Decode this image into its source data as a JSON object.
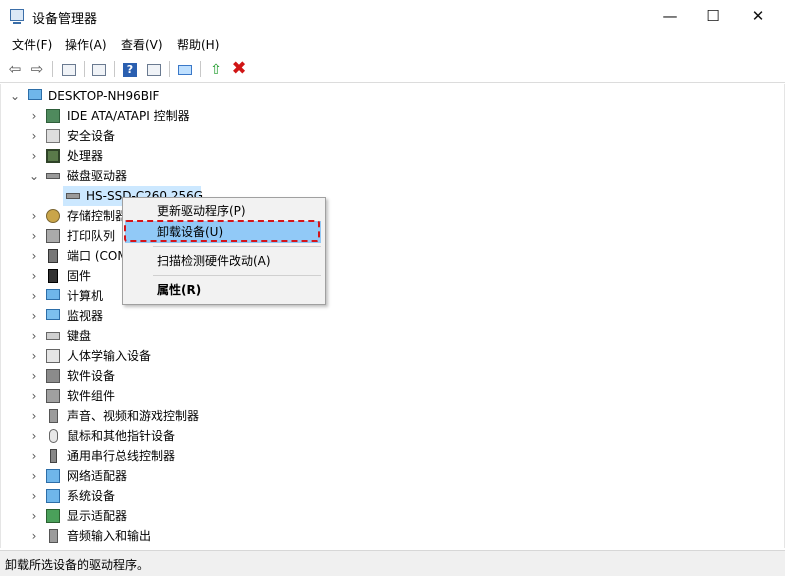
{
  "window": {
    "title": "设备管理器",
    "minimize_glyph": "—",
    "maximize_glyph": "☐",
    "close_glyph": "✕"
  },
  "menu": [
    "文件(F)",
    "操作(A)",
    "查看(V)",
    "帮助(H)"
  ],
  "toolbar": {
    "back_glyph": "⇦",
    "forward_glyph": "⇨",
    "help_glyph": "?",
    "update_glyph": "⇧",
    "uninstall_glyph": "✖"
  },
  "tree": {
    "root": "DESKTOP-NH96BIF",
    "expand_open": "⌄",
    "expand_closed": "›",
    "categories": [
      {
        "label": "IDE ATA/ATAPI 控制器",
        "icon": "ide-controller-icon"
      },
      {
        "label": "安全设备",
        "icon": "security-device-icon"
      },
      {
        "label": "处理器",
        "icon": "processor-icon"
      },
      {
        "label": "磁盘驱动器",
        "icon": "disk-drive-icon",
        "expanded": true
      },
      {
        "label": "存储控制器",
        "icon": "storage-controller-icon"
      },
      {
        "label": "打印队列",
        "icon": "print-queue-icon"
      },
      {
        "label": "端口 (COM",
        "icon": "port-icon"
      },
      {
        "label": "固件",
        "icon": "firmware-icon"
      },
      {
        "label": "计算机",
        "icon": "computer-icon"
      },
      {
        "label": "监视器",
        "icon": "monitor-icon"
      },
      {
        "label": "键盘",
        "icon": "keyboard-icon"
      },
      {
        "label": "人体学输入设备",
        "icon": "hid-icon"
      },
      {
        "label": "软件设备",
        "icon": "software-device-icon"
      },
      {
        "label": "软件组件",
        "icon": "software-component-icon"
      },
      {
        "label": "声音、视频和游戏控制器",
        "icon": "sound-icon"
      },
      {
        "label": "鼠标和其他指针设备",
        "icon": "mouse-icon"
      },
      {
        "label": "通用串行总线控制器",
        "icon": "usb-icon"
      },
      {
        "label": "网络适配器",
        "icon": "network-adapter-icon"
      },
      {
        "label": "系统设备",
        "icon": "system-device-icon"
      },
      {
        "label": "显示适配器",
        "icon": "display-adapter-icon"
      },
      {
        "label": "音频输入和输出",
        "icon": "audio-io-icon"
      }
    ],
    "disk_child": "HS-SSD-C260 256G"
  },
  "context_menu": {
    "items": [
      "更新驱动程序(P)",
      "卸载设备(U)",
      "扫描检测硬件改动(A)",
      "属性(R)"
    ]
  },
  "status": {
    "text": "卸载所选设备的驱动程序。"
  }
}
